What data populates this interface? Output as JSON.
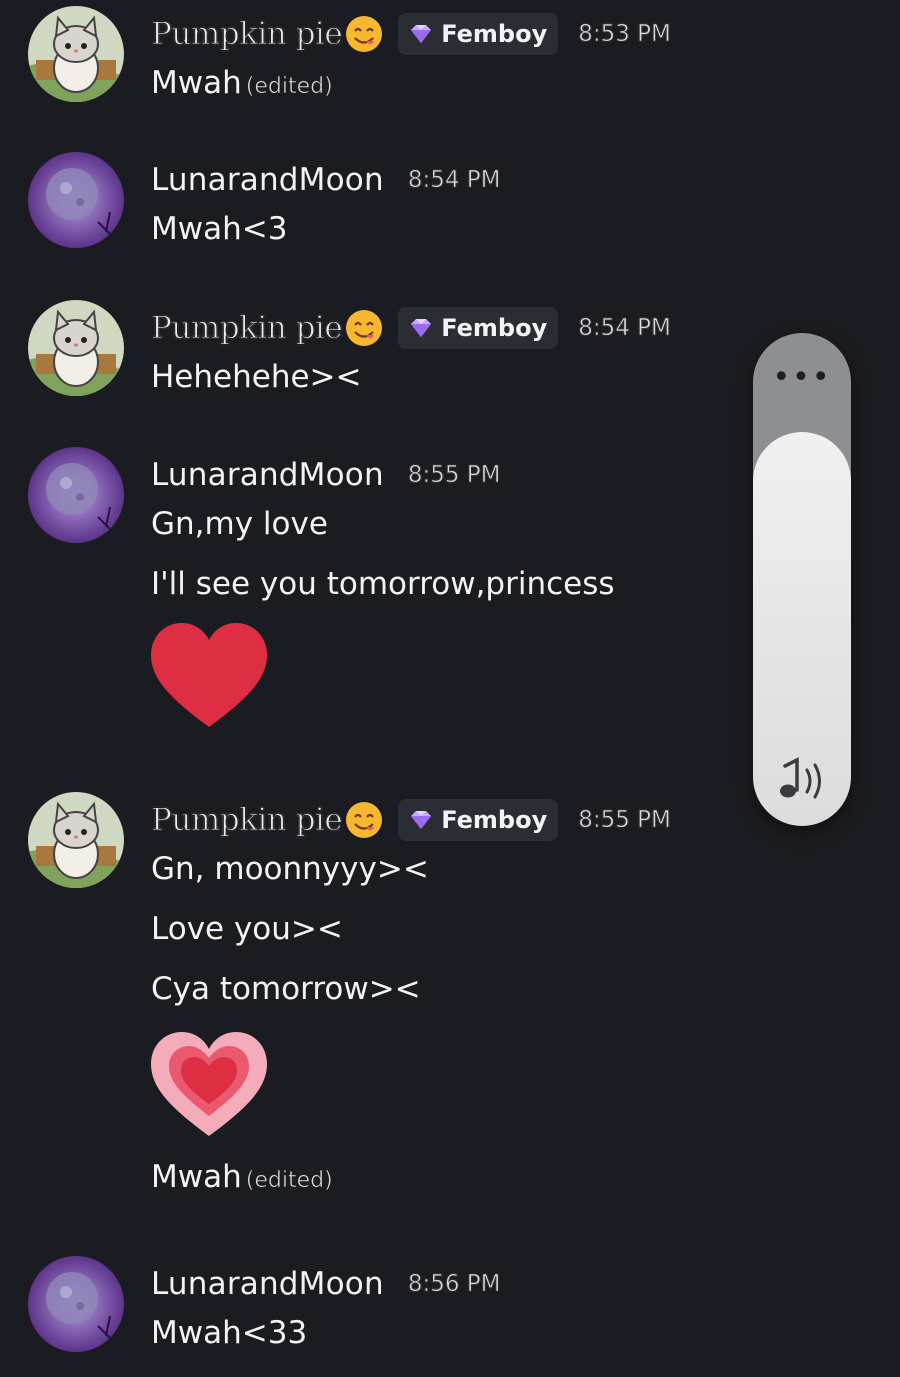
{
  "messages": [
    {
      "user": "Pumpkin pie",
      "tag": "Femboy",
      "time": "8:53 PM",
      "lines": [
        {
          "text": "Mwah",
          "edited": "(edited)"
        }
      ]
    },
    {
      "user": "LunarandMoon",
      "time": "8:54 PM",
      "lines": [
        {
          "text": "Mwah<3"
        }
      ]
    },
    {
      "user": "Pumpkin pie",
      "tag": "Femboy",
      "time": "8:54 PM",
      "lines": [
        {
          "text": "Hehehehe><"
        }
      ]
    },
    {
      "user": "LunarandMoon",
      "time": "8:55 PM",
      "lines": [
        {
          "text": "Gn,my love"
        },
        {
          "text": "I'll see you tomorrow,princess"
        }
      ],
      "emoji": "red-heart-icon"
    },
    {
      "user": "Pumpkin pie",
      "tag": "Femboy",
      "time": "8:55 PM",
      "lines": [
        {
          "text": "Gn, moonnyyy><"
        },
        {
          "text": "Love you><"
        },
        {
          "text": "Cya tomorrow><"
        }
      ],
      "emoji": "pink-heart-icon",
      "after_emoji": {
        "text": "Mwah",
        "edited": "(edited)"
      }
    },
    {
      "user": "LunarandMoon",
      "time": "8:56 PM",
      "lines": [
        {
          "text": "Mwah<33"
        }
      ]
    }
  ],
  "volume_overlay": {
    "more_label": "•••",
    "level": 0.8,
    "icon": "speaker-sound-icon"
  },
  "colors": {
    "background": "#1b1c21",
    "tag_background": "#2b2d34",
    "heart_red": "#dd2e44",
    "heart_pink": "#f4abba"
  }
}
